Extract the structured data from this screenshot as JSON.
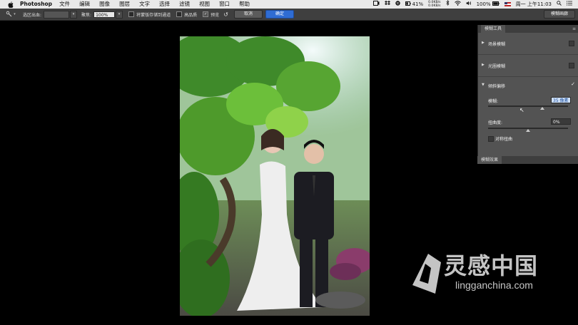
{
  "menubar": {
    "app": "Photoshop",
    "items": [
      "文件",
      "编辑",
      "图像",
      "图层",
      "文字",
      "选择",
      "滤镜",
      "视图",
      "窗口",
      "帮助"
    ],
    "net_up": "0.0KB/s",
    "net_down": "0.0KB/s",
    "battery": "41%",
    "battery2": "100%",
    "clock": "周一 上午11:03"
  },
  "options": {
    "selection_bleed": "选区出血:",
    "focus": "聚焦:",
    "focus_value": "100%",
    "save_mask": "将蒙版存储到通道",
    "high_quality": "高品质",
    "preview": "预览",
    "cancel": "取消",
    "ok": "确定",
    "gallery": "模糊画廊"
  },
  "panel": {
    "title": "模糊工具",
    "field_blur": "场景模糊",
    "iris_blur": "光圈模糊",
    "tilt_shift": "倾斜偏移",
    "blur_label": "模糊:",
    "blur_value": "35 像素",
    "blur_fraction": 0.68,
    "distortion_label": "扭曲度:",
    "distortion_value": "0%",
    "distortion_fraction": 0.5,
    "symmetric": "对称扭曲",
    "effects_tab": "模糊效果"
  },
  "watermark": {
    "title": "灵感中国",
    "url": "lingganchina.com"
  },
  "colors": {
    "accent": "#2f6cd3",
    "panel": "#535353",
    "canvas": "#000000"
  }
}
